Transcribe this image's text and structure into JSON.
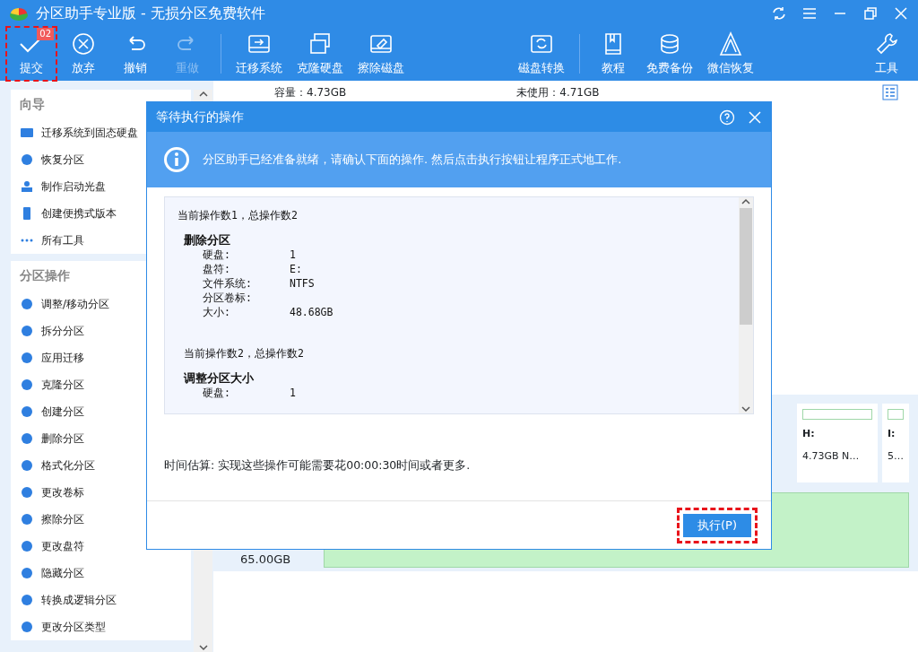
{
  "window": {
    "title": "分区助手专业版 - 无损分区免费软件"
  },
  "toolbar": [
    {
      "label": "提交",
      "disabled": false,
      "badge": "02",
      "highlighted": true
    },
    {
      "label": "放弃",
      "disabled": false,
      "highlighted": false
    },
    {
      "label": "撤销",
      "disabled": false,
      "highlighted": false
    },
    {
      "label": "重做",
      "disabled": true,
      "highlighted": false
    },
    {
      "label": "迁移系统",
      "disabled": false,
      "highlighted": false
    },
    {
      "label": "克隆硬盘",
      "disabled": false,
      "highlighted": false
    },
    {
      "label": "擦除磁盘",
      "disabled": false,
      "highlighted": false
    },
    {
      "label": "磁盘转换",
      "disabled": false,
      "highlighted": false
    },
    {
      "label": "教程",
      "disabled": false,
      "highlighted": false
    },
    {
      "label": "免费备份",
      "disabled": false,
      "highlighted": false
    },
    {
      "label": "微信恢复",
      "disabled": false,
      "highlighted": false
    },
    {
      "label": "工具",
      "disabled": false,
      "highlighted": false
    }
  ],
  "sidebar": [
    {
      "title": "向导",
      "items": [
        "迁移系统到固态硬盘",
        "恢复分区",
        "制作启动光盘",
        "创建便携式版本",
        "所有工具"
      ]
    },
    {
      "title": "分区操作",
      "items": [
        "调整/移动分区",
        "拆分分区",
        "应用迁移",
        "克隆分区",
        "创建分区",
        "删除分区",
        "格式化分区",
        "更改卷标",
        "擦除分区",
        "更改盘符",
        "隐藏分区",
        "转换成逻辑分区",
        "更改分区类型"
      ]
    }
  ],
  "disk_info": {
    "capacity": "容量：4.73GB",
    "unused": "未使用：4.71GB"
  },
  "partitions": [
    {
      "letter": "H:",
      "size": "4.73GB N…"
    },
    {
      "letter": "I:",
      "size": "5…"
    }
  ],
  "disk_size": "65.00GB",
  "dialog": {
    "title": "等待执行的操作",
    "info": "分区助手已经准备就绪，请确认下面的操作. 然后点击执行按钮让程序正式地工作.",
    "operations": [
      {
        "header": "当前操作数1，总操作数2",
        "title": "删除分区",
        "fields": [
          {
            "label": "硬盘:",
            "value": "1"
          },
          {
            "label": "盘符:",
            "value": "E:"
          },
          {
            "label": "文件系统:",
            "value": "NTFS"
          },
          {
            "label": "分区卷标:"
          },
          {
            "label": "大小:",
            "value": "48.68GB"
          }
        ]
      },
      {
        "header": "当前操作数2，总操作数2",
        "title": "调整分区大小",
        "fields": [
          {
            "label": "硬盘:",
            "value": "1"
          }
        ]
      }
    ],
    "estimate": "时间估算: 实现这些操作可能需要花00:00:30时间或者更多.",
    "button": {
      "label": "执行(P)",
      "highlighted": true
    }
  }
}
